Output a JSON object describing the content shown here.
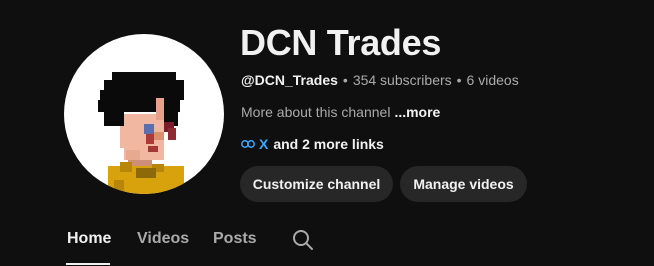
{
  "channel": {
    "name": "DCN Trades",
    "handle": "@DCN_Trades",
    "subscribers": "354 subscribers",
    "videos": "6 videos",
    "separator": "•",
    "about_text": "More about this channel",
    "about_more": "...more",
    "link_x": "X",
    "more_links": "and 2 more links"
  },
  "buttons": {
    "customize": "Customize channel",
    "manage": "Manage videos"
  },
  "tabs": [
    {
      "label": "Home",
      "active": true
    },
    {
      "label": "Videos",
      "active": false
    },
    {
      "label": "Posts",
      "active": false
    }
  ],
  "icons": {
    "link": "link-icon",
    "search": "search-icon"
  },
  "colors": {
    "background": "#0f0f0f",
    "button": "#272727",
    "link": "#3ea6ff",
    "text_primary": "#f1f1f1",
    "text_secondary": "#aaaaaa"
  }
}
